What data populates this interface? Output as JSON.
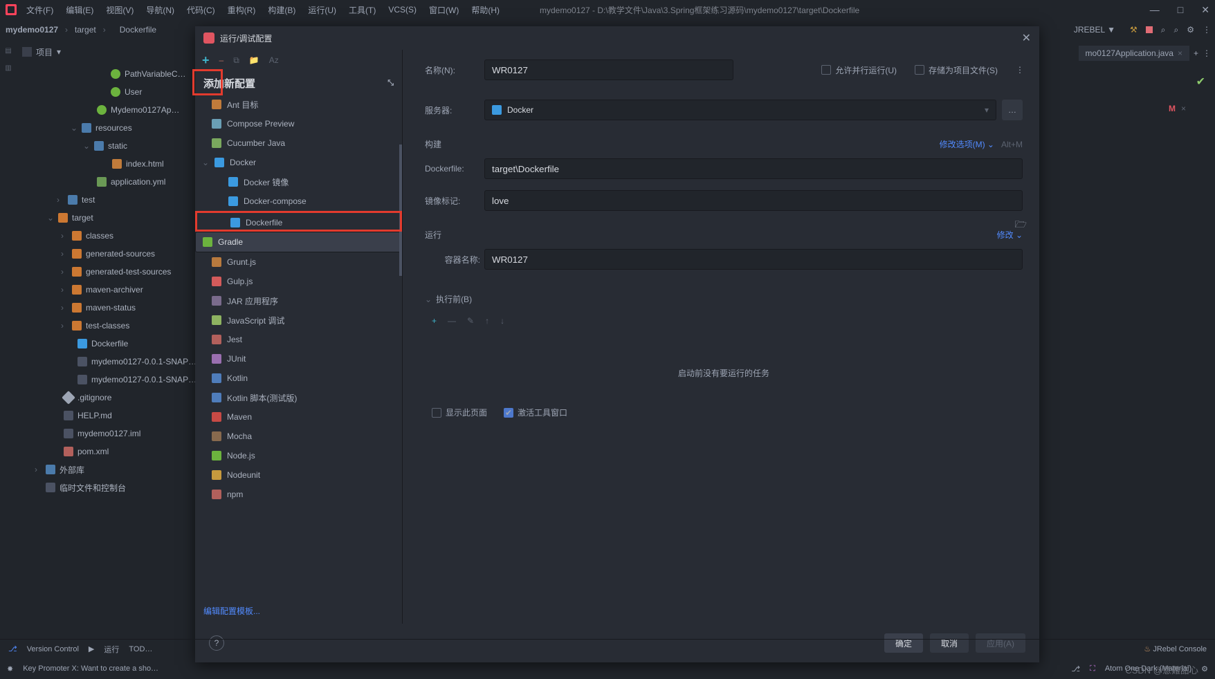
{
  "menubar": {
    "items": [
      "文件(F)",
      "编辑(E)",
      "视图(V)",
      "导航(N)",
      "代码(C)",
      "重构(R)",
      "构建(B)",
      "运行(U)",
      "工具(T)",
      "VCS(S)",
      "窗口(W)",
      "帮助(H)"
    ],
    "title": "mydemo0127 - D:\\教学文件\\Java\\3.Spring框架练习源码\\mydemo0127\\target\\Dockerfile",
    "winctrl": [
      "—",
      "□",
      "✕"
    ]
  },
  "breadcrumb": {
    "items": [
      "mydemo0127",
      "target",
      "Dockerfile"
    ],
    "sep": "›"
  },
  "toolbar_right": {
    "jrebel": "JREBEL",
    "icons": [
      "▼",
      "✔",
      "■",
      "文",
      "⌕",
      "⚙",
      "⋮"
    ]
  },
  "project_header": {
    "label": "项目",
    "dd": "▾"
  },
  "project_tree": [
    {
      "ind": 120,
      "icon": "spring",
      "label": "PathVariableC…"
    },
    {
      "ind": 120,
      "icon": "spring",
      "label": "User"
    },
    {
      "ind": 100,
      "icon": "spring",
      "label": "Mydemo0127Ap…"
    },
    {
      "ind": 78,
      "chev": "⌄",
      "icon": "folder-blue",
      "label": "resources"
    },
    {
      "ind": 96,
      "chev": "⌄",
      "icon": "folder-blue",
      "label": "static"
    },
    {
      "ind": 122,
      "icon": "html",
      "label": "index.html"
    },
    {
      "ind": 100,
      "icon": "yml",
      "label": "application.yml"
    },
    {
      "ind": 58,
      "chev": "›",
      "icon": "folder-blue",
      "label": "test"
    },
    {
      "ind": 44,
      "chev": "⌄",
      "icon": "folder",
      "label": "target"
    },
    {
      "ind": 64,
      "chev": "›",
      "icon": "folder",
      "label": "classes"
    },
    {
      "ind": 64,
      "chev": "›",
      "icon": "folder",
      "label": "generated-sources"
    },
    {
      "ind": 64,
      "chev": "›",
      "icon": "folder",
      "label": "generated-test-sources"
    },
    {
      "ind": 64,
      "chev": "›",
      "icon": "folder",
      "label": "maven-archiver"
    },
    {
      "ind": 64,
      "chev": "›",
      "icon": "folder",
      "label": "maven-status"
    },
    {
      "ind": 64,
      "chev": "›",
      "icon": "folder",
      "label": "test-classes"
    },
    {
      "ind": 72,
      "icon": "docker",
      "label": "Dockerfile"
    },
    {
      "ind": 72,
      "icon": "file",
      "label": "mydemo0127-0.0.1-SNAP…"
    },
    {
      "ind": 72,
      "icon": "file",
      "label": "mydemo0127-0.0.1-SNAP…"
    },
    {
      "ind": 52,
      "icon": "git",
      "label": ".gitignore"
    },
    {
      "ind": 52,
      "icon": "file",
      "label": "HELP.md"
    },
    {
      "ind": 52,
      "icon": "file",
      "label": "mydemo0127.iml"
    },
    {
      "ind": 52,
      "icon": "xml",
      "label": "pom.xml"
    },
    {
      "ind": 26,
      "chev": "›",
      "icon": "folder-blue",
      "label": "外部库"
    },
    {
      "ind": 26,
      "chev": "",
      "icon": "file",
      "label": "临时文件和控制台"
    }
  ],
  "editor": {
    "tabs": [
      {
        "label": "mo0127Application.java",
        "close": "×"
      }
    ],
    "plus": "+",
    "more": "⋮",
    "check": "✔",
    "run_marker": "M",
    "run_close": "×"
  },
  "dialog": {
    "title": "运行/调试配置",
    "toolbar": {
      "plus": "+",
      "minus": "–",
      "copy": "⧉",
      "folder": "📁",
      "sort": "Aᴢ"
    },
    "heading": "添加新配置",
    "collapse": "⤡",
    "configs": [
      {
        "icon": "ant",
        "label": "Ant 目标"
      },
      {
        "icon": "compose",
        "label": "Compose Preview"
      },
      {
        "icon": "cucumber",
        "label": "Cucumber Java"
      },
      {
        "icon": "docker",
        "label": "Docker",
        "chev": "⌄"
      },
      {
        "icon": "docker",
        "label": "Docker 镜像",
        "indent": true
      },
      {
        "icon": "docker",
        "label": "Docker-compose",
        "indent": true
      },
      {
        "icon": "docker",
        "label": "Dockerfile",
        "indent": true,
        "selected": true,
        "redbox": true
      },
      {
        "icon": "gradle",
        "label": "Gradle",
        "selected_bg": true
      },
      {
        "icon": "grunt",
        "label": "Grunt.js"
      },
      {
        "icon": "gulp",
        "label": "Gulp.js"
      },
      {
        "icon": "jar",
        "label": "JAR 应用程序"
      },
      {
        "icon": "js",
        "label": "JavaScript 调试"
      },
      {
        "icon": "jest",
        "label": "Jest"
      },
      {
        "icon": "junit",
        "label": "JUnit"
      },
      {
        "icon": "kotlin",
        "label": "Kotlin"
      },
      {
        "icon": "kotlin",
        "label": "Kotlin 脚本(测试版)"
      },
      {
        "icon": "maven",
        "label": "Maven"
      },
      {
        "icon": "mocha",
        "label": "Mocha"
      },
      {
        "icon": "node",
        "label": "Node.js"
      },
      {
        "icon": "nodeunit",
        "label": "Nodeunit"
      },
      {
        "icon": "npm",
        "label": "npm"
      }
    ],
    "edit_templates": "编辑配置模板...",
    "form": {
      "name_label": "名称(N):",
      "name_value": "WR0127",
      "parallel": "允许并行运行(U)",
      "store": "存储为项目文件(S)",
      "server_label": "服务器:",
      "server_value": "Docker",
      "ellipsis": "…",
      "build_sect": "构建",
      "modify": "修改选项(M)",
      "modify_dd": "⌄",
      "modify_hint": "Alt+M",
      "dockerfile_label": "Dockerfile:",
      "dockerfile_value": "target\\Dockerfile",
      "image_label": "镜像标记:",
      "image_value": "love",
      "run_sect": "运行",
      "run_mod": "修改",
      "run_dd": "⌄",
      "container_label": "容器名称:",
      "container_value": "WR0127",
      "before_label": "执行前(B)",
      "before_chev": "⌄",
      "before_tools": [
        "+",
        "—",
        "✎",
        "↑",
        "↓"
      ],
      "empty_text": "启动前没有要运行的任务",
      "show_page": "显示此页面",
      "activate_tool": "激活工具窗口"
    },
    "buttons": {
      "ok": "确定",
      "cancel": "取消",
      "apply": "应用(A)",
      "help": "?"
    }
  },
  "status": {
    "left": [
      "Version Control",
      "运行",
      "TOD…"
    ],
    "vcs_icon": "⎇",
    "run_icon": "▶",
    "right": [
      "JRebel Console"
    ],
    "bottom_msg": "Key Promoter X: Want to create a sho…",
    "bottom_right": [
      "Atom One Dark (Material)",
      "⚙"
    ],
    "branch": "⎇"
  },
  "watermark": "CSDN @意難甜心"
}
